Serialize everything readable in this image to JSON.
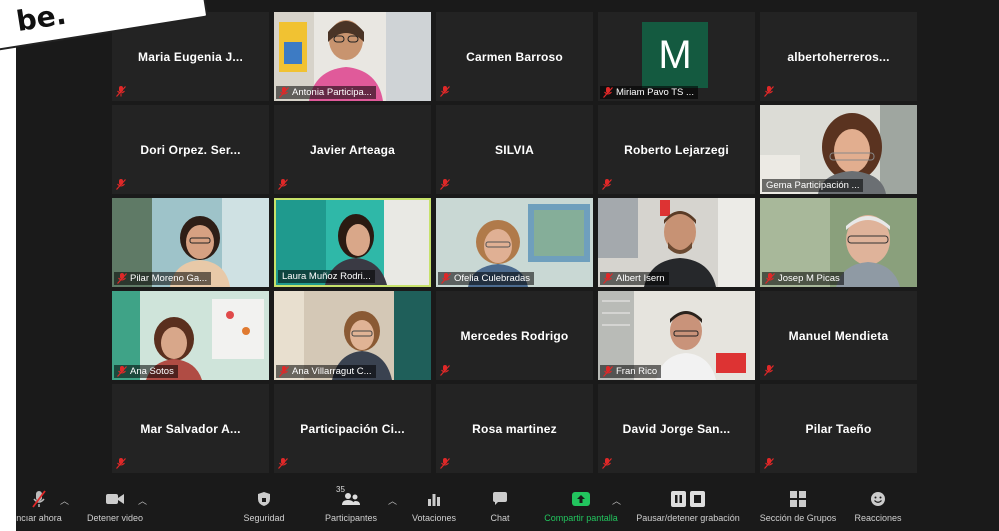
{
  "sticker_text": "be.",
  "participants": [
    {
      "id": "maria",
      "label": "Maria Eugenia J...",
      "video": false
    },
    {
      "id": "antonia",
      "label": "Antonia Participa...",
      "video": true
    },
    {
      "id": "carmen",
      "label": "Carmen Barroso",
      "video": false
    },
    {
      "id": "miriam",
      "label": "Miriam Pavo TS ...",
      "video": false,
      "avatar_letter": "M"
    },
    {
      "id": "alberto",
      "label": "albertoherreros...",
      "video": false
    },
    {
      "id": "dori",
      "label": "Dori Orpez.  Ser...",
      "video": false
    },
    {
      "id": "javier",
      "label": "Javier Arteaga",
      "video": false
    },
    {
      "id": "silvia",
      "label": "SILVIA",
      "video": false
    },
    {
      "id": "roberto",
      "label": "Roberto Lejarzegi",
      "video": false
    },
    {
      "id": "gema",
      "label": "Gema Participación ...",
      "video": true
    },
    {
      "id": "pilar-m",
      "label": "Pilar Moreno Ga...",
      "video": true
    },
    {
      "id": "laura",
      "label": "Laura Muñoz Rodri...",
      "video": true,
      "active_speaker": true
    },
    {
      "id": "ofelia",
      "label": "Ofelia Culebradas",
      "video": true
    },
    {
      "id": "albert",
      "label": "Albert Isern",
      "video": true
    },
    {
      "id": "josep",
      "label": "Josep M Picas",
      "video": true
    },
    {
      "id": "ana-s",
      "label": "Ana Sotos",
      "video": true
    },
    {
      "id": "ana-v",
      "label": "Ana Villarragut C...",
      "video": true
    },
    {
      "id": "mercedes",
      "label": "Mercedes Rodrigo",
      "video": false
    },
    {
      "id": "fran",
      "label": "Fran Rico",
      "video": true
    },
    {
      "id": "manuel",
      "label": "Manuel Mendieta",
      "video": false
    },
    {
      "id": "mar",
      "label": "Mar Salvador A...",
      "video": false
    },
    {
      "id": "participacion",
      "label": "Participación  Ci...",
      "video": false
    },
    {
      "id": "rosa",
      "label": "Rosa martinez",
      "video": false
    },
    {
      "id": "david",
      "label": "David Jorge San...",
      "video": false
    },
    {
      "id": "pilar-t",
      "label": "Pilar Taeño",
      "video": false
    }
  ],
  "toolbar": {
    "mute_label": "ncıar ahora",
    "video_label": "Detener video",
    "security_label": "Seguridad",
    "participants_label": "Participantes",
    "participants_count": "35",
    "polls_label": "Votaciones",
    "chat_label": "Chat",
    "share_label": "Compartir pantalla",
    "record_label": "Pausar/detener grabación",
    "breakout_label": "Sección de Grupos",
    "reactions_label": "Reacciones"
  },
  "colors": {
    "active_border": "#c7e26b",
    "share_green": "#22c55e",
    "muted_red": "#e02828",
    "avatar_green": "#145a40"
  }
}
